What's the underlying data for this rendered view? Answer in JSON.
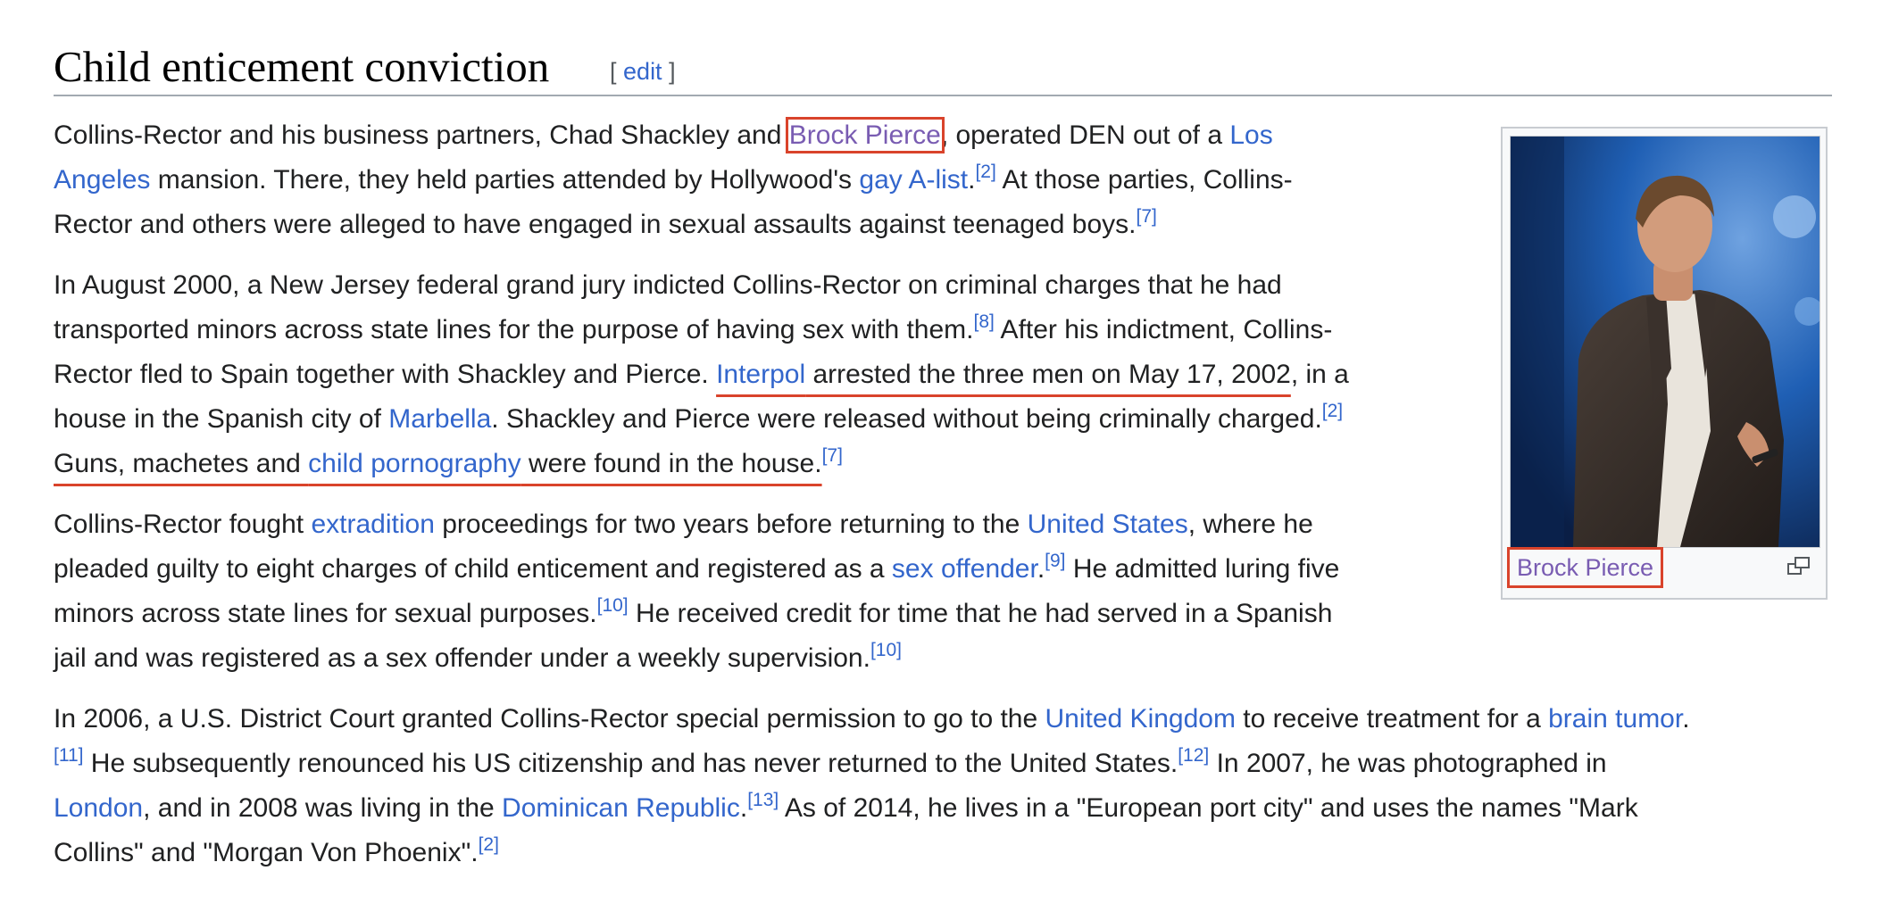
{
  "section": {
    "title": "Child enticement conviction",
    "edit_open": "[",
    "edit_label": "edit",
    "edit_close": "]"
  },
  "paragraphs": [
    [
      [
        {
          "t": "Collins-Rector and his business partners, Chad Shackley and "
        },
        {
          "t": "Brock Pierce",
          "link": true,
          "visited": true,
          "box": true
        },
        {
          "t": ", operated DEN out of a "
        },
        {
          "t": "Los",
          "link": true
        }
      ],
      [
        {
          "t": "Angeles",
          "link": true
        },
        {
          "t": " mansion. There, they held parties attended by Hollywood's "
        },
        {
          "t": "gay A-list",
          "link": true
        },
        {
          "t": "."
        },
        {
          "t": "[2]",
          "sup": true
        },
        {
          "t": " At those parties, Collins-"
        }
      ],
      [
        {
          "t": "Rector and others were alleged to have engaged in sexual assaults against teenaged boys."
        },
        {
          "t": "[7]",
          "sup": true
        }
      ]
    ],
    [
      [
        {
          "t": "In August 2000, a New Jersey federal grand jury indicted Collins-Rector on criminal charges that he had"
        }
      ],
      [
        {
          "t": "transported minors across state lines for the purpose of having sex with them."
        },
        {
          "t": "[8]",
          "sup": true
        },
        {
          "t": " After his indictment, Collins-"
        }
      ],
      [
        {
          "t": "Rector fled to Spain together with Shackley and Pierce. "
        },
        {
          "t": "Interpol",
          "link": true,
          "underline": true
        },
        {
          "t": " arrested the three men on May 17, 2002",
          "underline": true
        },
        {
          "t": ", in a"
        }
      ],
      [
        {
          "t": "house in the Spanish city of "
        },
        {
          "t": "Marbella",
          "link": true
        },
        {
          "t": ". Shackley and Pierce were released without being criminally charged."
        },
        {
          "t": "[2]",
          "sup": true
        }
      ],
      [
        {
          "t": "Guns, machetes and ",
          "underline": true
        },
        {
          "t": "child pornography",
          "link": true,
          "underline": true
        },
        {
          "t": " were found in the house.",
          "underline": true
        },
        {
          "t": "[7]",
          "sup": true
        }
      ]
    ],
    [
      [
        {
          "t": "Collins-Rector fought "
        },
        {
          "t": "extradition",
          "link": true
        },
        {
          "t": " proceedings for two years before returning to the "
        },
        {
          "t": "United States",
          "link": true
        },
        {
          "t": ", where he"
        }
      ],
      [
        {
          "t": "pleaded guilty to eight charges of child enticement and registered as a "
        },
        {
          "t": "sex offender",
          "link": true
        },
        {
          "t": "."
        },
        {
          "t": "[9]",
          "sup": true
        },
        {
          "t": " He admitted luring five"
        }
      ],
      [
        {
          "t": "minors across state lines for sexual purposes."
        },
        {
          "t": "[10]",
          "sup": true
        },
        {
          "t": " He received credit for time that he had served in a Spanish"
        }
      ],
      [
        {
          "t": "jail and was registered as a sex offender under a weekly supervision."
        },
        {
          "t": "[10]",
          "sup": true
        }
      ]
    ],
    [
      [
        {
          "t": "In 2006, a U.S. District Court granted Collins-Rector special permission to go to the "
        },
        {
          "t": "United Kingdom",
          "link": true
        },
        {
          "t": " to receive treatment for a "
        },
        {
          "t": "brain tumor",
          "link": true
        },
        {
          "t": "."
        }
      ],
      [
        {
          "t": "[11]",
          "sup": true
        },
        {
          "t": " He subsequently renounced his US citizenship and has never returned to the United States."
        },
        {
          "t": "[12]",
          "sup": true
        },
        {
          "t": " In 2007, he was photographed in"
        }
      ],
      [
        {
          "t": "London",
          "link": true
        },
        {
          "t": ", and in 2008 was living in the "
        },
        {
          "t": "Dominican Republic",
          "link": true
        },
        {
          "t": "."
        },
        {
          "t": "[13]",
          "sup": true
        },
        {
          "t": " As of 2014, he lives in a \"European port city\" and uses the names \"Mark"
        }
      ],
      [
        {
          "t": "Collins\" and \"Morgan Von Phoenix\"."
        },
        {
          "t": "[2]",
          "sup": true
        }
      ]
    ]
  ],
  "figure": {
    "caption": "Brock Pierce",
    "photo_icon": "person-photo",
    "magnify_icon": "magnify-clip-icon"
  },
  "colors": {
    "link": "#3366cc",
    "visited": "#795cb2",
    "annotation": "#d9432b",
    "text": "#202122"
  }
}
